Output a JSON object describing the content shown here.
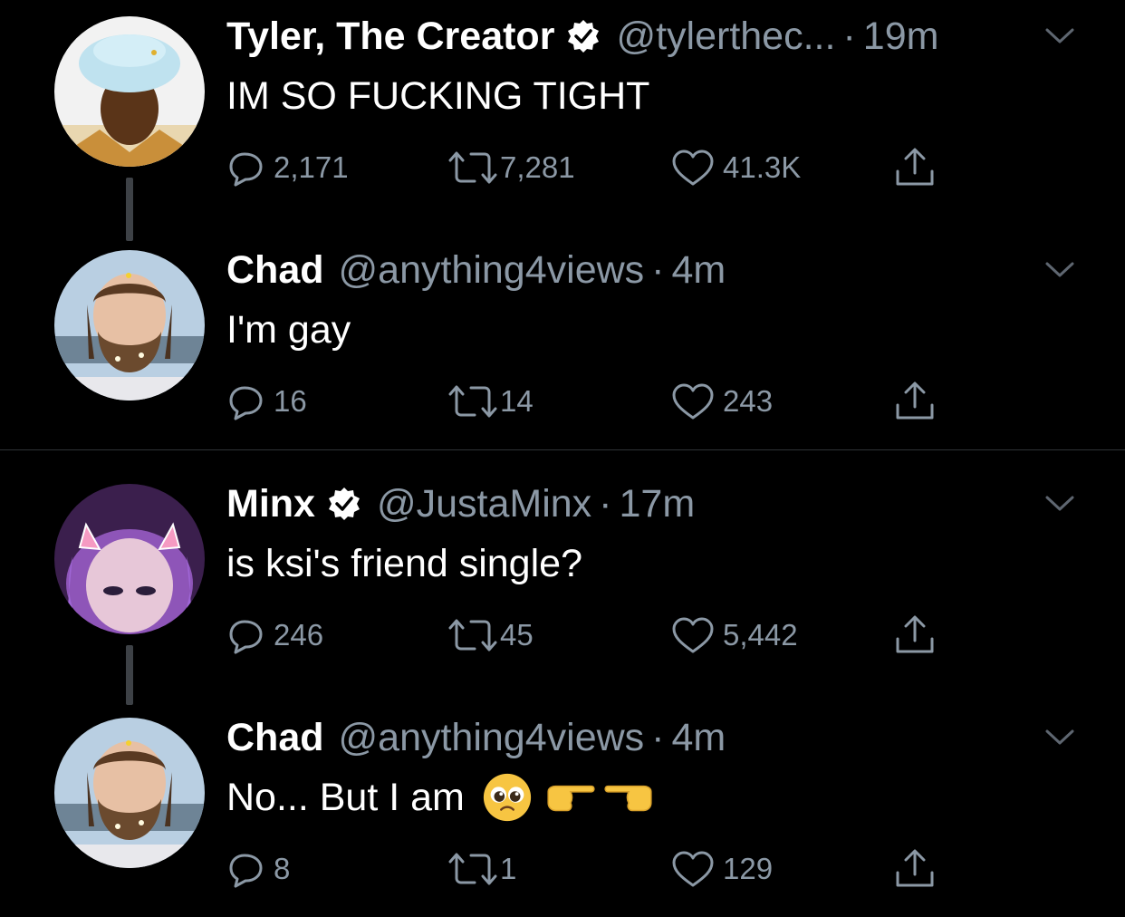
{
  "tweets": [
    {
      "name": "Tyler, The Creator",
      "handle": "@tylerthec...",
      "sep": "·",
      "time": "19m",
      "text": "IM SO FUCKING TIGHT",
      "replies": "2,171",
      "retweets": "7,281",
      "likes": "41.3K",
      "verified": true,
      "avatar": "tyler-avatar"
    },
    {
      "name": "Chad",
      "handle": "@anything4views",
      "sep": "·",
      "time": "4m",
      "text": "I'm gay",
      "replies": "16",
      "retweets": "14",
      "likes": "243",
      "verified": false,
      "avatar": "chad-avatar"
    },
    {
      "name": "Minx",
      "handle": "@JustaMinx",
      "sep": "·",
      "time": "17m",
      "text": "is ksi's friend single?",
      "replies": "246",
      "retweets": "45",
      "likes": "5,442",
      "verified": true,
      "avatar": "minx-avatar"
    },
    {
      "name": "Chad",
      "handle": "@anything4views",
      "sep": "·",
      "time": "4m",
      "text": "No... But I am",
      "emojis": [
        "pleading-face-emoji",
        "pointing-right-emoji",
        "pointing-left-emoji"
      ],
      "replies": "8",
      "retweets": "1",
      "likes": "129",
      "verified": false,
      "avatar": "chad-avatar"
    }
  ],
  "colors": {
    "background": "#000000",
    "text": "#ffffff",
    "secondary": "#8b98a5",
    "thread_line": "#3d4146",
    "divider": "#2f3336"
  },
  "icons": [
    "reply-icon",
    "retweet-icon",
    "like-icon",
    "share-icon",
    "chevron-down-icon",
    "verified-badge-icon"
  ]
}
